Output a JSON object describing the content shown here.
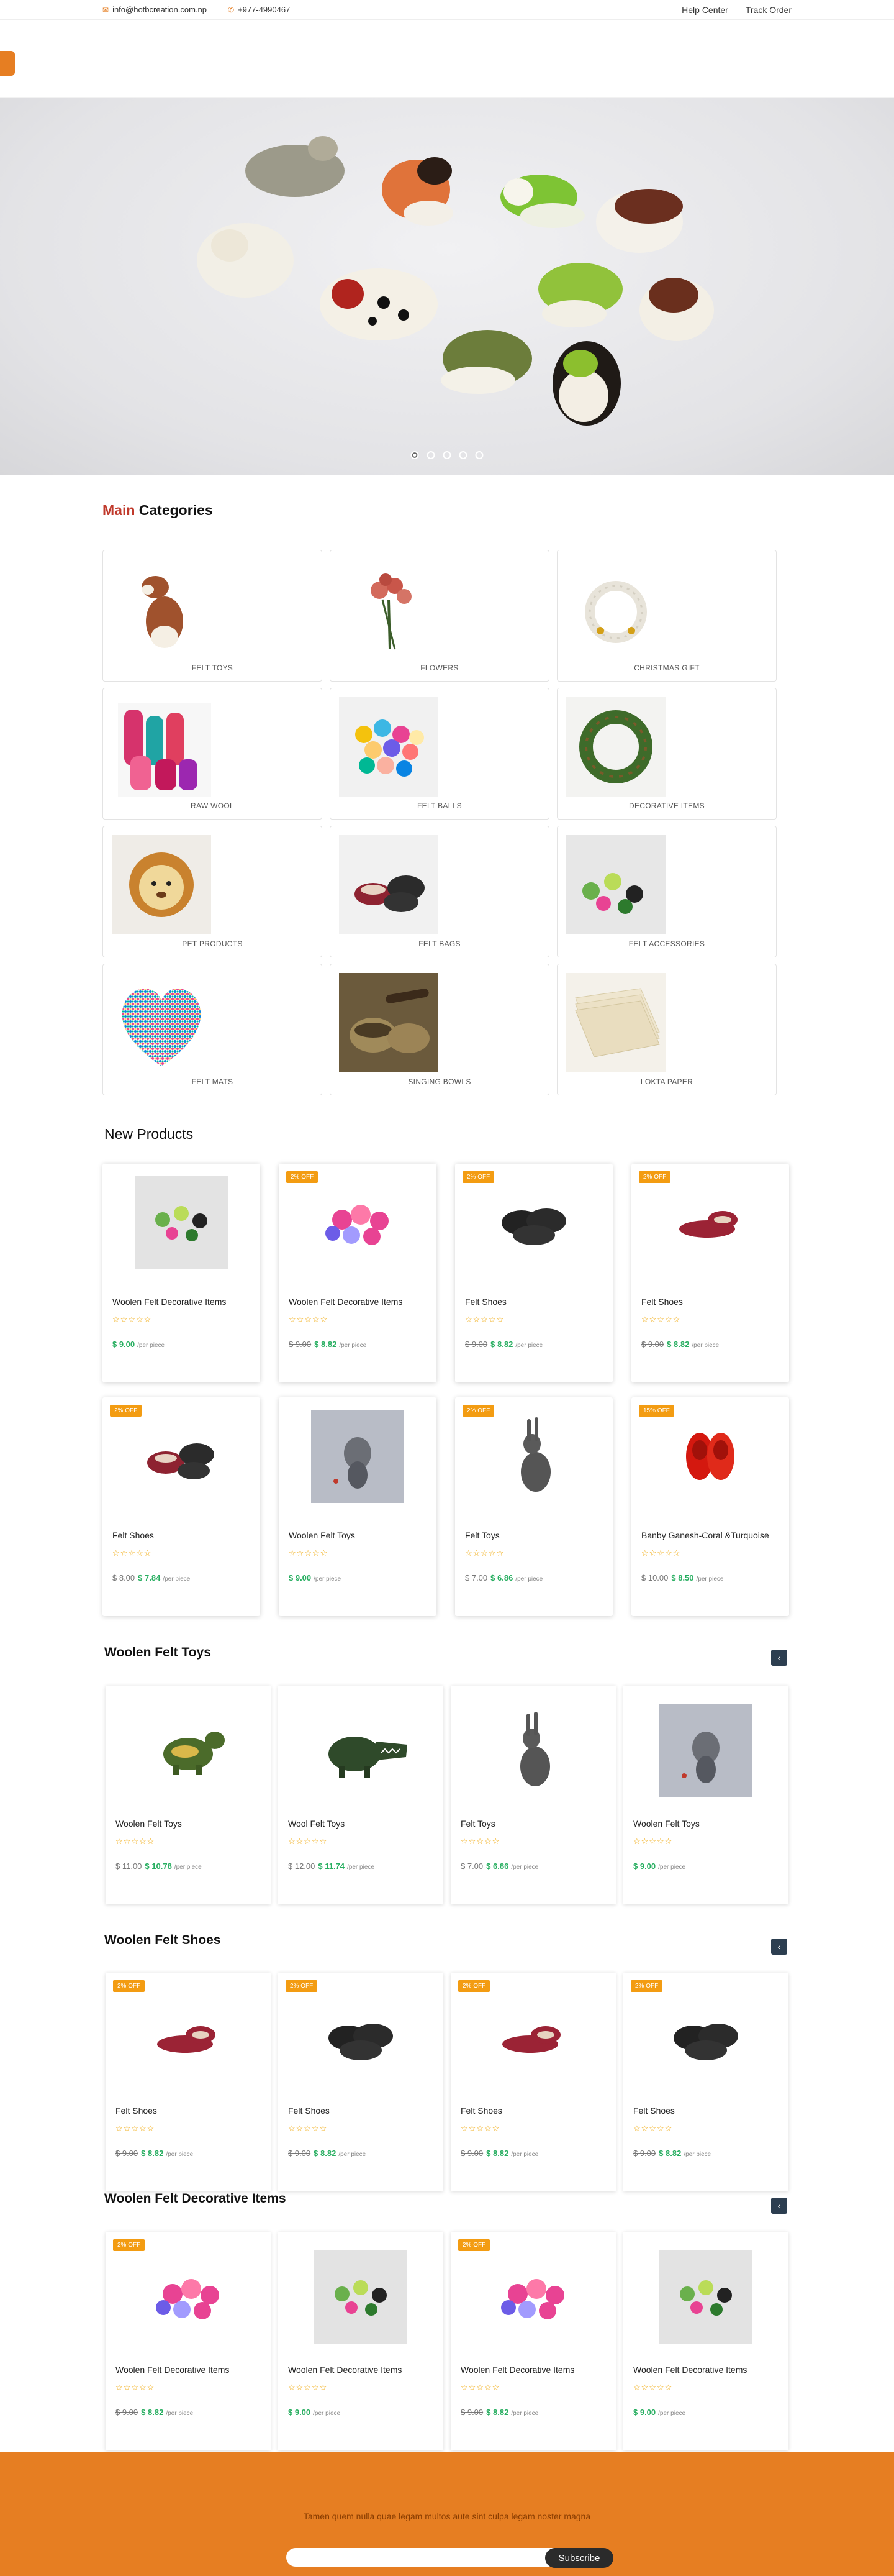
{
  "topbar": {
    "email": "info@hotbcreation.com.np",
    "phone": "+977-4990467",
    "help_center": "Help Center",
    "track_order": "Track Order"
  },
  "colors": {
    "accent": "#e67e22",
    "price_green": "#27ae60",
    "title_red": "#c0392b",
    "badge": "#f39c12",
    "dark": "#2c3e50"
  },
  "main_categories": {
    "title_accent": "Main",
    "title_rest": "Categories",
    "items": [
      {
        "label": "FELT TOYS",
        "icon": "dog-toy"
      },
      {
        "label": "FLOWERS",
        "icon": "flower-bouquet"
      },
      {
        "label": "CHRISTMAS GIFT",
        "icon": "wreath-white"
      },
      {
        "label": "RAW WOOL",
        "icon": "wool-rolls"
      },
      {
        "label": "FELT BALLS",
        "icon": "colorful-balls"
      },
      {
        "label": "DECORATIVE ITEMS",
        "icon": "wreath-green"
      },
      {
        "label": "PET PRODUCTS",
        "icon": "lion-toy"
      },
      {
        "label": "FELT BAGS",
        "icon": "felt-shoes"
      },
      {
        "label": "FELT ACCESSORIES",
        "icon": "small-birds"
      },
      {
        "label": "FELT MATS",
        "icon": "heart-mat"
      },
      {
        "label": "SINGING BOWLS",
        "icon": "singing-bowls"
      },
      {
        "label": "LOKTA PAPER",
        "icon": "paper-stack"
      }
    ]
  },
  "new_products": {
    "title": "New Products",
    "items": [
      {
        "name": "Woolen Felt Decorative Items",
        "badge": "",
        "old_price": "",
        "price": "$ 9.00",
        "unit": "/per piece"
      },
      {
        "name": "Woolen Felt Decorative Items",
        "badge": "2% OFF",
        "old_price": "$ 9.00",
        "price": "$ 8.82",
        "unit": "/per piece"
      },
      {
        "name": "Felt Shoes",
        "badge": "2% OFF",
        "old_price": "$ 9.00",
        "price": "$ 8.82",
        "unit": "/per piece"
      },
      {
        "name": "Felt Shoes",
        "badge": "2% OFF",
        "old_price": "$ 9.00",
        "price": "$ 8.82",
        "unit": "/per piece"
      },
      {
        "name": "Felt Shoes",
        "badge": "2% OFF",
        "old_price": "$ 8.00",
        "price": "$ 7.84",
        "unit": "/per piece"
      },
      {
        "name": "Woolen Felt Toys",
        "badge": "",
        "old_price": "",
        "price": "$ 9.00",
        "unit": "/per piece"
      },
      {
        "name": "Felt Toys",
        "badge": "2% OFF",
        "old_price": "$ 7.00",
        "price": "$ 6.86",
        "unit": "/per piece"
      },
      {
        "name": "Banby Ganesh-Coral &Turquoise",
        "badge": "15% OFF",
        "old_price": "$ 10.00",
        "price": "$ 8.50",
        "unit": "/per piece"
      }
    ]
  },
  "woolen_felt_toys": {
    "title": "Woolen Felt Toys",
    "arrow": "‹",
    "items": [
      {
        "name": "Woolen Felt Toys",
        "old_price": "$ 11.00",
        "price": "$ 10.78",
        "unit": "/per piece"
      },
      {
        "name": "Wool Felt Toys",
        "old_price": "$ 12.00",
        "price": "$ 11.74",
        "unit": "/per piece"
      },
      {
        "name": "Felt Toys",
        "old_price": "$ 7.00",
        "price": "$ 6.86",
        "unit": "/per piece"
      },
      {
        "name": "Woolen Felt Toys",
        "old_price": "",
        "price": "$ 9.00",
        "unit": "/per piece"
      }
    ]
  },
  "woolen_felt_shoes": {
    "title": "Woolen Felt Shoes",
    "arrow": "‹",
    "items": [
      {
        "name": "Felt Shoes",
        "badge": "2% OFF",
        "old_price": "$ 9.00",
        "price": "$ 8.82",
        "unit": "/per piece"
      },
      {
        "name": "Felt Shoes",
        "badge": "2% OFF",
        "old_price": "$ 9.00",
        "price": "$ 8.82",
        "unit": "/per piece"
      },
      {
        "name": "Felt Shoes",
        "badge": "2% OFF",
        "old_price": "$ 9.00",
        "price": "$ 8.82",
        "unit": "/per piece"
      },
      {
        "name": "Felt Shoes",
        "badge": "2% OFF",
        "old_price": "$ 9.00",
        "price": "$ 8.82",
        "unit": "/per piece"
      }
    ]
  },
  "woolen_felt_decorative": {
    "title": "Woolen Felt Decorative Items",
    "arrow": "‹",
    "items": [
      {
        "name": "Woolen Felt Decorative Items",
        "badge": "2% OFF",
        "old_price": "$ 9.00",
        "price": "$ 8.82",
        "unit": "/per piece"
      },
      {
        "name": "Woolen Felt Decorative Items",
        "badge": "",
        "old_price": "",
        "price": "$ 9.00",
        "unit": "/per piece"
      },
      {
        "name": "Woolen Felt Decorative Items",
        "badge": "2% OFF",
        "old_price": "$ 9.00",
        "price": "$ 8.82",
        "unit": "/per piece"
      },
      {
        "name": "Woolen Felt Decorative Items",
        "badge": "",
        "old_price": "",
        "price": "$ 9.00",
        "unit": "/per piece"
      }
    ]
  },
  "stars": "☆☆☆☆☆",
  "footer": {
    "tagline": "Tamen quem nulla quae legam multos aute sint culpa legam noster magna",
    "subscribe_label": "Subscribe",
    "input_placeholder": ""
  }
}
